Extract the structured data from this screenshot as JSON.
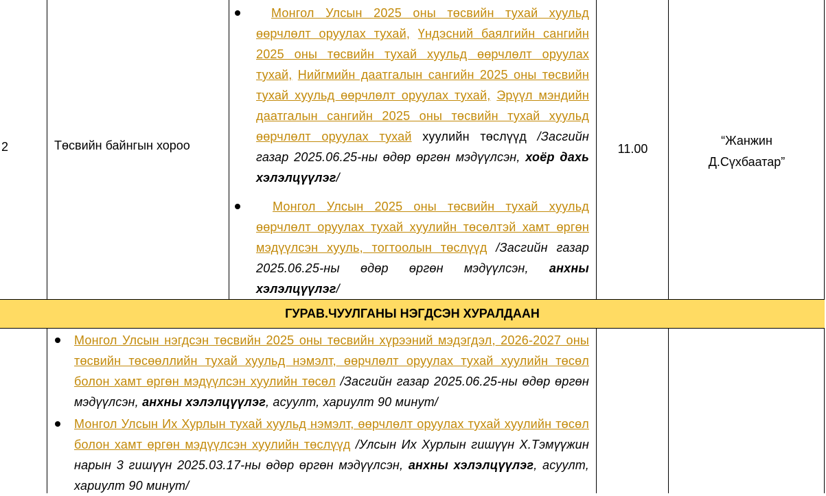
{
  "row2": {
    "number": "2",
    "committee": "Төсвийн байнгын хороо",
    "time": "11.00",
    "hall": {
      "line1": "“Жанжин",
      "line2": "Д.Сүхбаатар”"
    },
    "item1": {
      "link1": "Монгол Улсын 2025 оны төсвийн тухай хуульд өөрчлөлт оруулах тухай,",
      "link2": "Үндэсний баялгийн сангийн 2025 оны төсвийн тухай хуульд өөрчлөлт оруулах тухай,",
      "link3": "Нийгмийн даатгалын сангийн 2025 оны төсвийн тухай хуульд өөрчлөлт оруулах тухай,",
      "link4": "Эрүүл мэндийн даатгалын сангийн 2025 оны төсвийн тухай хуульд өөрчлөлт оруулах тухай",
      "plain": "хуулийн төслүүд",
      "note": "/Засгийн газар 2025.06.25-ны өдөр өргөн мэдүүлсэн,",
      "note_bold": "хоёр дахь хэлэлцүүлэг",
      "note_end": "/"
    },
    "item2": {
      "link": "Монгол Улсын 2025 оны төсвийн тухай хуульд өөрчлөлт оруулах тухай хуулийн төсөлтэй хамт өргөн мэдүүлсэн хууль, тогтоолын төслүүд",
      "note": "/Засгийн газар 2025.06.25-ны өдөр өргөн мэдүүлсэн,",
      "note_bold": "анхны хэлэлцүүлэг",
      "note_end": "/"
    }
  },
  "section": {
    "title": "ГУРАВ.ЧУУЛГАНЫ НЭГДСЭН ХУРАЛДААН"
  },
  "row3": {
    "item1": {
      "link": "Монгол Улсын нэгдсэн төсвийн 2025 оны төсвийн хүрээний мэдэгдэл, 2026-2027 оны төсвийн төсөөллийн тухай хуульд нэмэлт, өөрчлөлт оруулах тухай хуулийн төсөл болон хамт өргөн мэдүүлсэн хуулийн төсөл",
      "note": "/Засгийн газар 2025.06.25-ны өдөр өргөн мэдүүлсэн,",
      "note_bold": "анхны хэлэлцүүлэг",
      "note_end": ", асуулт, хариулт 90 минут/"
    },
    "item2": {
      "link": "Монгол Улсын Их Хурлын тухай хуульд нэмэлт, өөрчлөлт оруулах тухай хуулийн төсөл болон хамт өргөн мэдүүлсэн хуулийн төслүүд",
      "note": "/Улсын Их Хурлын гишүүн Х.Тэмүүжин нарын 3 гишүүн 2025.03.17-ны өдөр өргөн мэдүүлсэн,",
      "note_bold": "анхны хэлэлцүүлэг",
      "note_end": ", асуулт, хариулт 90 минут/"
    }
  }
}
